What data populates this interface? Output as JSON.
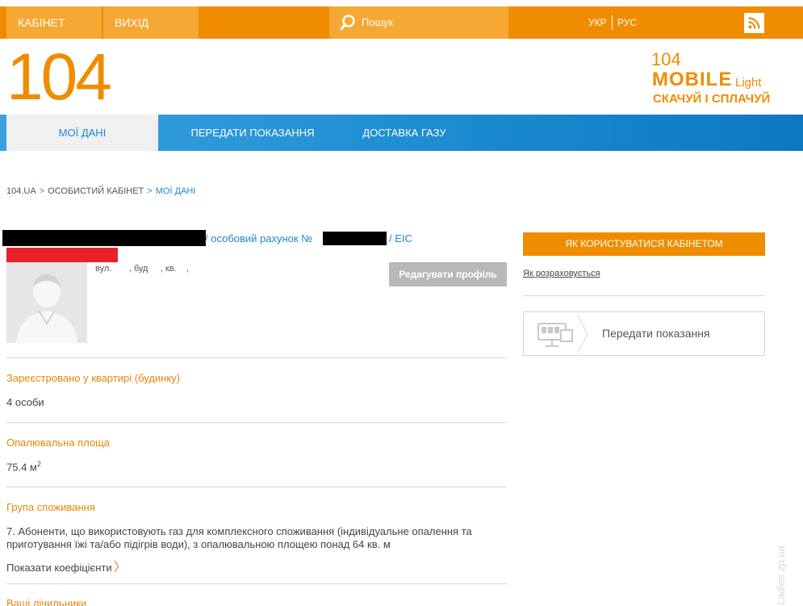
{
  "topbar": {
    "cabinet_label": "КАБІНЕТ",
    "exit_label": "ВИХІД",
    "search_placeholder": "Пошук",
    "lang_ukr": "УКР",
    "lang_rus": "РУС"
  },
  "logo": {
    "main": "104",
    "mobile_104": "104",
    "mobile_word": "MOBILE",
    "mobile_light": "Light",
    "mobile_slogan": "СКАЧУЙ І СПЛАЧУЙ"
  },
  "nav": {
    "items": [
      {
        "label": "МОЇ ДАНІ"
      },
      {
        "label": "ПЕРЕДАТИ ПОКАЗАННЯ"
      },
      {
        "label": "ДОСТАВКА ГАЗУ"
      }
    ]
  },
  "breadcrumb": {
    "home": "104.UA",
    "sep": ">",
    "cabinet": "ОСОБИСТИЙ КАБІНЕТ",
    "current": "МОЇ ДАНІ"
  },
  "profile": {
    "account_prefix": "/ особовий рахунок №",
    "eic_prefix": "/ EIC",
    "address_street": "вул.",
    "address_building": ", буд",
    "address_apt": ", кв.",
    "address_end": ",",
    "edit_label": "Редагувати профіль"
  },
  "sections": {
    "registered_title": "Зареєстровано у квартирі (будинку)",
    "registered_value": "4 особи",
    "area_title": "Опалювальна площа",
    "area_value": "75.4 м",
    "area_unit_sup": "2",
    "group_title": "Група споживання",
    "group_value": "7. Абоненти, що використовують газ для комплексного споживання (індивідуальне опалення та приготування їжі та/або підігрів води), з опалювальною площею понад 64 кв. м",
    "coef_link": "Показати коефіцієнти",
    "meters_title": "Ваші лічильники"
  },
  "sidebar": {
    "howto_label": "ЯК КОРИСТУВАТИСЯ КАБІНЕТОМ",
    "calc_link": "Як розраховується",
    "meter_card_label": "Передати показання"
  },
  "watermark": "Ladies zp.ua",
  "colors": {
    "brand_orange": "#f08c00",
    "nav_blue": "#1a8ad0",
    "section_title": "#e8860a"
  }
}
